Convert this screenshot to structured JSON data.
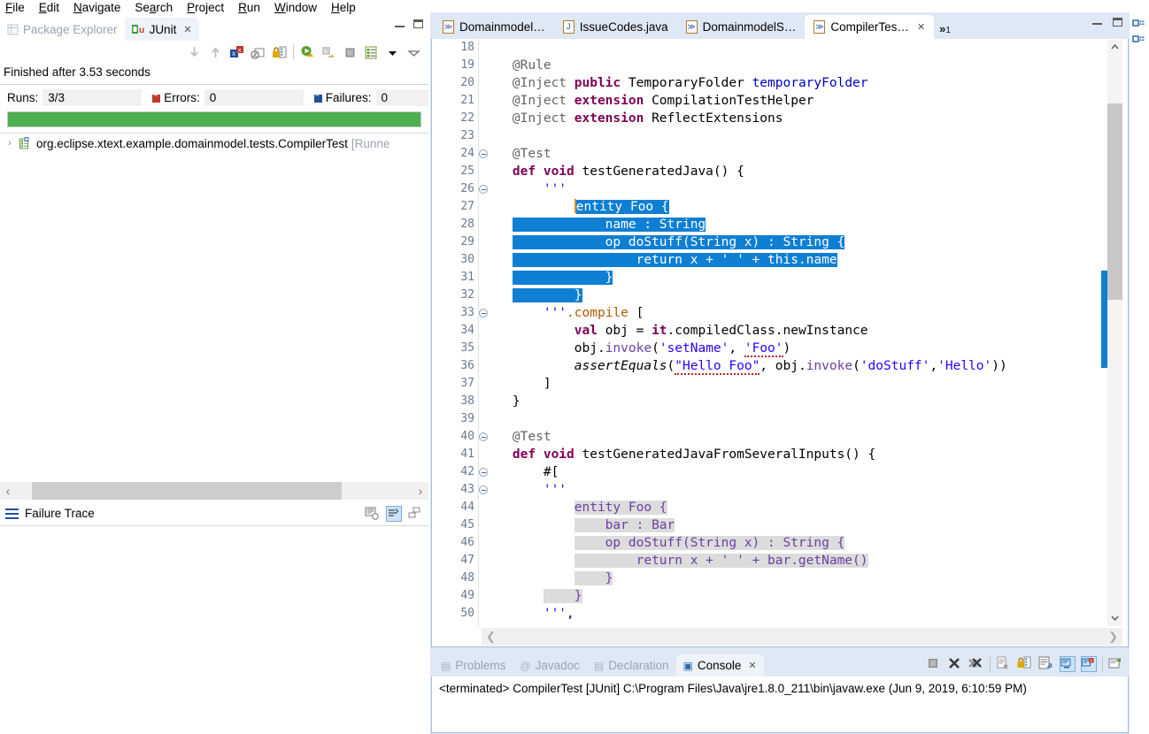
{
  "menubar": {
    "items": [
      {
        "label": "File",
        "mnemonic": "F"
      },
      {
        "label": "Edit",
        "mnemonic": "E"
      },
      {
        "label": "Navigate",
        "mnemonic": "N"
      },
      {
        "label": "Search",
        "mnemonic": "a"
      },
      {
        "label": "Project",
        "mnemonic": "P"
      },
      {
        "label": "Run",
        "mnemonic": "R"
      },
      {
        "label": "Window",
        "mnemonic": "W"
      },
      {
        "label": "Help",
        "mnemonic": "H"
      }
    ]
  },
  "junit_view": {
    "tabs": [
      {
        "label": "Package Explorer",
        "icon": "package-explorer-icon",
        "active": false,
        "closable": false
      },
      {
        "label": "JUnit",
        "icon": "junit-icon",
        "active": true,
        "closable": true
      }
    ],
    "close_glyph": "✕",
    "toolbar_icons": [
      "next-failure-icon",
      "previous-failure-icon",
      "show-failures-only-icon",
      "stop-on-error-icon",
      "lock-scroll-icon",
      "rerun-test-icon",
      "rerun-failed-icon",
      "stop-icon",
      "view-menu-list-icon",
      "dropdown-arrow-icon",
      "view-menu-icon"
    ],
    "status_text": "Finished after 3.53 seconds",
    "counters": {
      "runs_label": "Runs:",
      "runs_value": "3/3",
      "errors_label": "Errors:",
      "errors_value": "0",
      "failures_label": "Failures:",
      "failures_value": "0"
    },
    "progress": {
      "percent": 100,
      "color": "#4caf50"
    },
    "tree": [
      {
        "arrow": "›",
        "icon": "test-suite-icon",
        "label": "org.eclipse.xtext.example.domainmodel.tests.CompilerTest",
        "suffix": "[Runne"
      }
    ],
    "failure_trace": {
      "title": "Failure Trace",
      "tools": [
        "compare-results-icon",
        "filter-stack-trace-icon",
        "maximize-icon"
      ]
    },
    "hscroll": {
      "left_arrow": "‹",
      "right_arrow": "›"
    }
  },
  "editor_stack": {
    "tabs": [
      {
        "label": "Domainmodel…",
        "icon": "xtend-file-icon",
        "active": false,
        "closable": false
      },
      {
        "label": "IssueCodes.java",
        "icon": "java-file-icon",
        "active": false,
        "closable": false
      },
      {
        "label": "DomainmodelS…",
        "icon": "xtend-file-icon",
        "active": false,
        "closable": false
      },
      {
        "label": "CompilerTes…",
        "icon": "xtend-file-icon",
        "active": true,
        "closable": true
      }
    ],
    "close_glyph": "✕",
    "overflow_label": "»",
    "overflow_count": "1",
    "hscroll": {
      "left_arrow": "❮",
      "right_arrow": "❯"
    }
  },
  "code": {
    "first_line": 18,
    "lines": [
      {
        "n": 18,
        "fold": false,
        "tokens": []
      },
      {
        "n": 19,
        "fold": false,
        "tokens": [
          {
            "t": "    ",
            "c": ""
          },
          {
            "t": "@Rule",
            "c": "an"
          }
        ]
      },
      {
        "n": 20,
        "fold": false,
        "tokens": [
          {
            "t": "    ",
            "c": ""
          },
          {
            "t": "@Inject",
            "c": "an"
          },
          {
            "t": " ",
            "c": ""
          },
          {
            "t": "public",
            "c": "k"
          },
          {
            "t": " TemporaryFolder ",
            "c": ""
          },
          {
            "t": "temporaryFolder",
            "c": "fld"
          }
        ]
      },
      {
        "n": 21,
        "fold": false,
        "tokens": [
          {
            "t": "    ",
            "c": ""
          },
          {
            "t": "@Inject",
            "c": "an"
          },
          {
            "t": " ",
            "c": ""
          },
          {
            "t": "extension",
            "c": "k"
          },
          {
            "t": " CompilationTestHelper",
            "c": ""
          }
        ]
      },
      {
        "n": 22,
        "fold": false,
        "tokens": [
          {
            "t": "    ",
            "c": ""
          },
          {
            "t": "@Inject",
            "c": "an"
          },
          {
            "t": " ",
            "c": ""
          },
          {
            "t": "extension",
            "c": "k"
          },
          {
            "t": " ReflectExtensions",
            "c": ""
          }
        ]
      },
      {
        "n": 23,
        "fold": false,
        "tokens": []
      },
      {
        "n": 24,
        "fold": true,
        "tokens": [
          {
            "t": "    ",
            "c": ""
          },
          {
            "t": "@Test",
            "c": "an"
          }
        ]
      },
      {
        "n": 25,
        "fold": false,
        "tokens": [
          {
            "t": "    ",
            "c": ""
          },
          {
            "t": "def void",
            "c": "k"
          },
          {
            "t": " testGeneratedJava() {",
            "c": ""
          }
        ]
      },
      {
        "n": 26,
        "fold": true,
        "tokens": [
          {
            "t": "        ",
            "c": ""
          },
          {
            "t": "'''",
            "c": "str"
          }
        ]
      },
      {
        "n": 27,
        "fold": false,
        "tokens": [
          {
            "t": "            ",
            "c": ""
          },
          {
            "t": "CARET",
            "c": "caret"
          },
          {
            "t": "entity Foo {",
            "c": "sel"
          }
        ]
      },
      {
        "n": 28,
        "fold": false,
        "tokens": [
          {
            "t": "    ",
            "c": ""
          },
          {
            "t": "            name : String",
            "c": "sel"
          }
        ]
      },
      {
        "n": 29,
        "fold": false,
        "tokens": [
          {
            "t": "    ",
            "c": ""
          },
          {
            "t": "            op doStuff(String x) : String {",
            "c": "sel"
          }
        ]
      },
      {
        "n": 30,
        "fold": false,
        "tokens": [
          {
            "t": "    ",
            "c": ""
          },
          {
            "t": "                return x + ' ' + this.name",
            "c": "sel"
          }
        ]
      },
      {
        "n": 31,
        "fold": false,
        "tokens": [
          {
            "t": "    ",
            "c": ""
          },
          {
            "t": "            }",
            "c": "sel"
          }
        ]
      },
      {
        "n": 32,
        "fold": false,
        "tokens": [
          {
            "t": "    ",
            "c": ""
          },
          {
            "t": "        }",
            "c": "sel"
          }
        ]
      },
      {
        "n": 33,
        "fold": true,
        "tokens": [
          {
            "t": "        ",
            "c": ""
          },
          {
            "t": "'''",
            "c": "str"
          },
          {
            "t": ".compile",
            "c": "str2"
          },
          {
            "t": " [",
            "c": ""
          }
        ]
      },
      {
        "n": 34,
        "fold": false,
        "tokens": [
          {
            "t": "            ",
            "c": ""
          },
          {
            "t": "val",
            "c": "k"
          },
          {
            "t": " obj = ",
            "c": ""
          },
          {
            "t": "it",
            "c": "k"
          },
          {
            "t": ".compiledClass.newInstance",
            "c": ""
          }
        ]
      },
      {
        "n": 35,
        "fold": false,
        "tokens": [
          {
            "t": "            obj.",
            "c": ""
          },
          {
            "t": "invoke",
            "c": "pur"
          },
          {
            "t": "(",
            "c": ""
          },
          {
            "t": "'setName'",
            "c": "str"
          },
          {
            "t": ", ",
            "c": ""
          },
          {
            "t": "'Foo'",
            "c": "str sq"
          },
          {
            "t": ")",
            "c": ""
          }
        ]
      },
      {
        "n": 36,
        "fold": false,
        "tokens": [
          {
            "t": "            ",
            "c": ""
          },
          {
            "t": "assertEquals",
            "c": "mth"
          },
          {
            "t": "(",
            "c": ""
          },
          {
            "t": "\"Hello Foo\"",
            "c": "str sq"
          },
          {
            "t": ", obj.",
            "c": ""
          },
          {
            "t": "invoke",
            "c": "pur"
          },
          {
            "t": "(",
            "c": ""
          },
          {
            "t": "'doStuff'",
            "c": "str"
          },
          {
            "t": ",",
            "c": ""
          },
          {
            "t": "'Hello'",
            "c": "str"
          },
          {
            "t": "))",
            "c": ""
          }
        ]
      },
      {
        "n": 37,
        "fold": false,
        "tokens": [
          {
            "t": "        ]",
            "c": ""
          }
        ]
      },
      {
        "n": 38,
        "fold": false,
        "tokens": [
          {
            "t": "    }",
            "c": ""
          }
        ]
      },
      {
        "n": 39,
        "fold": false,
        "tokens": []
      },
      {
        "n": 40,
        "fold": true,
        "tokens": [
          {
            "t": "    ",
            "c": ""
          },
          {
            "t": "@Test",
            "c": "an"
          }
        ]
      },
      {
        "n": 41,
        "fold": false,
        "tokens": [
          {
            "t": "    ",
            "c": ""
          },
          {
            "t": "def void",
            "c": "k"
          },
          {
            "t": " testGeneratedJavaFromSeveralInputs() {",
            "c": ""
          }
        ]
      },
      {
        "n": 42,
        "fold": true,
        "tokens": [
          {
            "t": "        #[",
            "c": ""
          }
        ]
      },
      {
        "n": 43,
        "fold": true,
        "tokens": [
          {
            "t": "        ",
            "c": ""
          },
          {
            "t": "'''",
            "c": "str"
          }
        ]
      },
      {
        "n": 44,
        "fold": false,
        "tokens": [
          {
            "t": "            ",
            "c": ""
          },
          {
            "t": "entity Foo {",
            "c": "tpl pur"
          }
        ]
      },
      {
        "n": 45,
        "fold": false,
        "tokens": [
          {
            "t": "            ",
            "c": ""
          },
          {
            "t": "    bar : Bar",
            "c": "tpl pur"
          }
        ]
      },
      {
        "n": 46,
        "fold": false,
        "tokens": [
          {
            "t": "            ",
            "c": ""
          },
          {
            "t": "    op doStuff(String x) : String {",
            "c": "tpl pur"
          }
        ]
      },
      {
        "n": 47,
        "fold": false,
        "tokens": [
          {
            "t": "            ",
            "c": ""
          },
          {
            "t": "        return x + ' ' + bar.getName()",
            "c": "tpl pur"
          }
        ]
      },
      {
        "n": 48,
        "fold": false,
        "tokens": [
          {
            "t": "            ",
            "c": ""
          },
          {
            "t": "    }",
            "c": "tpl pur"
          }
        ]
      },
      {
        "n": 49,
        "fold": false,
        "tokens": [
          {
            "t": "        ",
            "c": ""
          },
          {
            "t": "    }",
            "c": "tpl pur"
          }
        ]
      },
      {
        "n": 50,
        "fold": false,
        "tokens": [
          {
            "t": "        ",
            "c": ""
          },
          {
            "t": "'''",
            "c": "str"
          },
          {
            "t": ",",
            "c": ""
          }
        ]
      }
    ]
  },
  "console_stack": {
    "tabs": [
      {
        "label": "Problems",
        "icon": "problems-icon",
        "active": false,
        "closable": false
      },
      {
        "label": "Javadoc",
        "icon": "javadoc-icon",
        "active": false,
        "closable": false
      },
      {
        "label": "Declaration",
        "icon": "declaration-icon",
        "active": false,
        "closable": false
      },
      {
        "label": "Console",
        "icon": "console-icon",
        "active": true,
        "closable": true
      }
    ],
    "close_glyph": "✕",
    "toolbar_icons": [
      "terminate-icon",
      "remove-launch-icon",
      "remove-all-launches-icon",
      "clear-console-icon",
      "scroll-lock-icon",
      "word-wrap-icon",
      "show-console-on-output-icon",
      "show-console-on-error-icon",
      "open-console-icon"
    ],
    "output": "<terminated> CompilerTest [JUnit] C:\\Program Files\\Java\\jre1.8.0_211\\bin\\javaw.exe (Jun 9, 2019, 6:10:59 PM)"
  },
  "fastview": {
    "icons": [
      "java-perspective-icon",
      "debug-perspective-icon"
    ]
  },
  "colors": {
    "selection_blue": "#0f7fd4",
    "progress_green": "#4caf50",
    "template_gray": "#dcdcdc",
    "keyword_purple": "#7f0055",
    "string_blue": "#2a00ff",
    "caret_orange": "#e08a1e",
    "tab_active_bg": "#ffffff",
    "chrome_blue": "#dfe8f5"
  }
}
